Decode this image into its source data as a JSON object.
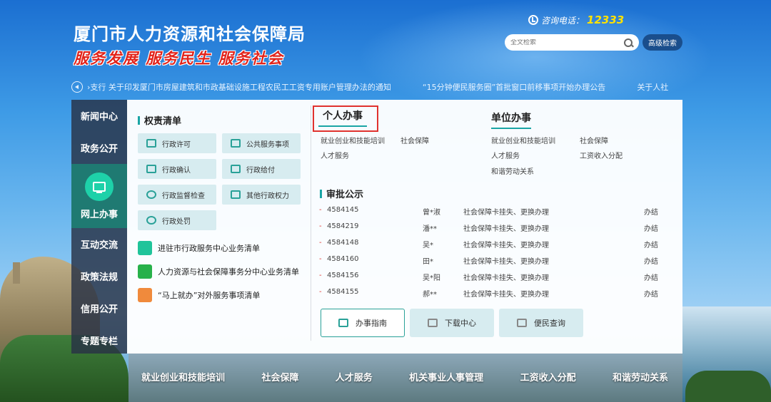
{
  "header": {
    "site_title": "厦门市人力资源和社会保障局",
    "slogan": "服务发展  服务民生  服务社会",
    "hotline_label": "咨询电话：",
    "hotline_number": "12333",
    "search_placeholder": "全文检索",
    "advanced_search": "高级检索"
  },
  "ticker": [
    "›支行 关于印发厦门市房屋建筑和市政基础设施工程农民工工资专用账户管理办法的通知",
    "“15分钟便民服务圈”首批窗口前移事项开始办理公告",
    "关于人社"
  ],
  "left_nav": [
    "新闻中心",
    "政务公开",
    "网上办事",
    "互动交流",
    "政策法规",
    "信用公开",
    "专题专栏"
  ],
  "rights": {
    "title": "权责清单",
    "buttons": [
      "行政许可",
      "公共服务事项",
      "行政确认",
      "行政给付",
      "行政监督检查",
      "其他行政权力",
      "行政处罚"
    ],
    "links": [
      "进驻市行政服务中心业务清单",
      "人力资源与社会保障事务分中心业务清单",
      "“马上就办”对外服务事项清单"
    ]
  },
  "personal": {
    "title": "个人办事",
    "links": [
      "就业创业和技能培训",
      "社会保障",
      "人才服务"
    ]
  },
  "unit": {
    "title": "单位办事",
    "links": [
      "就业创业和技能培训",
      "社会保障",
      "人才服务",
      "工资收入分配",
      "和谐劳动关系"
    ]
  },
  "approval": {
    "title": "审批公示",
    "rows": [
      {
        "dot": "-",
        "num": "4584145",
        "name": "曾*淑",
        "item": "社会保障卡挂失、更换办理",
        "status": "办结"
      },
      {
        "dot": "-",
        "num": "4584219",
        "name": "潘**",
        "item": "社会保障卡挂失、更换办理",
        "status": "办结"
      },
      {
        "dot": "-",
        "num": "4584148",
        "name": "吴*",
        "item": "社会保障卡挂失、更换办理",
        "status": "办结"
      },
      {
        "dot": "-",
        "num": "4584160",
        "name": "田*",
        "item": "社会保障卡挂失、更换办理",
        "status": "办结"
      },
      {
        "dot": "-",
        "num": "4584156",
        "name": "吴*阳",
        "item": "社会保障卡挂失、更换办理",
        "status": "办结"
      },
      {
        "dot": "-",
        "num": "4584155",
        "name": "郝**",
        "item": "社会保障卡挂失、更换办理",
        "status": "办结"
      }
    ]
  },
  "bottom_buttons": [
    "办事指南",
    "下载中心",
    "便民查询"
  ],
  "bottom_nav": [
    "就业创业和技能培训",
    "社会保障",
    "人才服务",
    "机关事业人事管理",
    "工资收入分配",
    "和谐劳动关系"
  ],
  "colors": {
    "accent": "#1aa5a5",
    "highlight": "#e0322e",
    "slogan": "#e2231a",
    "hotline": "#ffe200"
  }
}
